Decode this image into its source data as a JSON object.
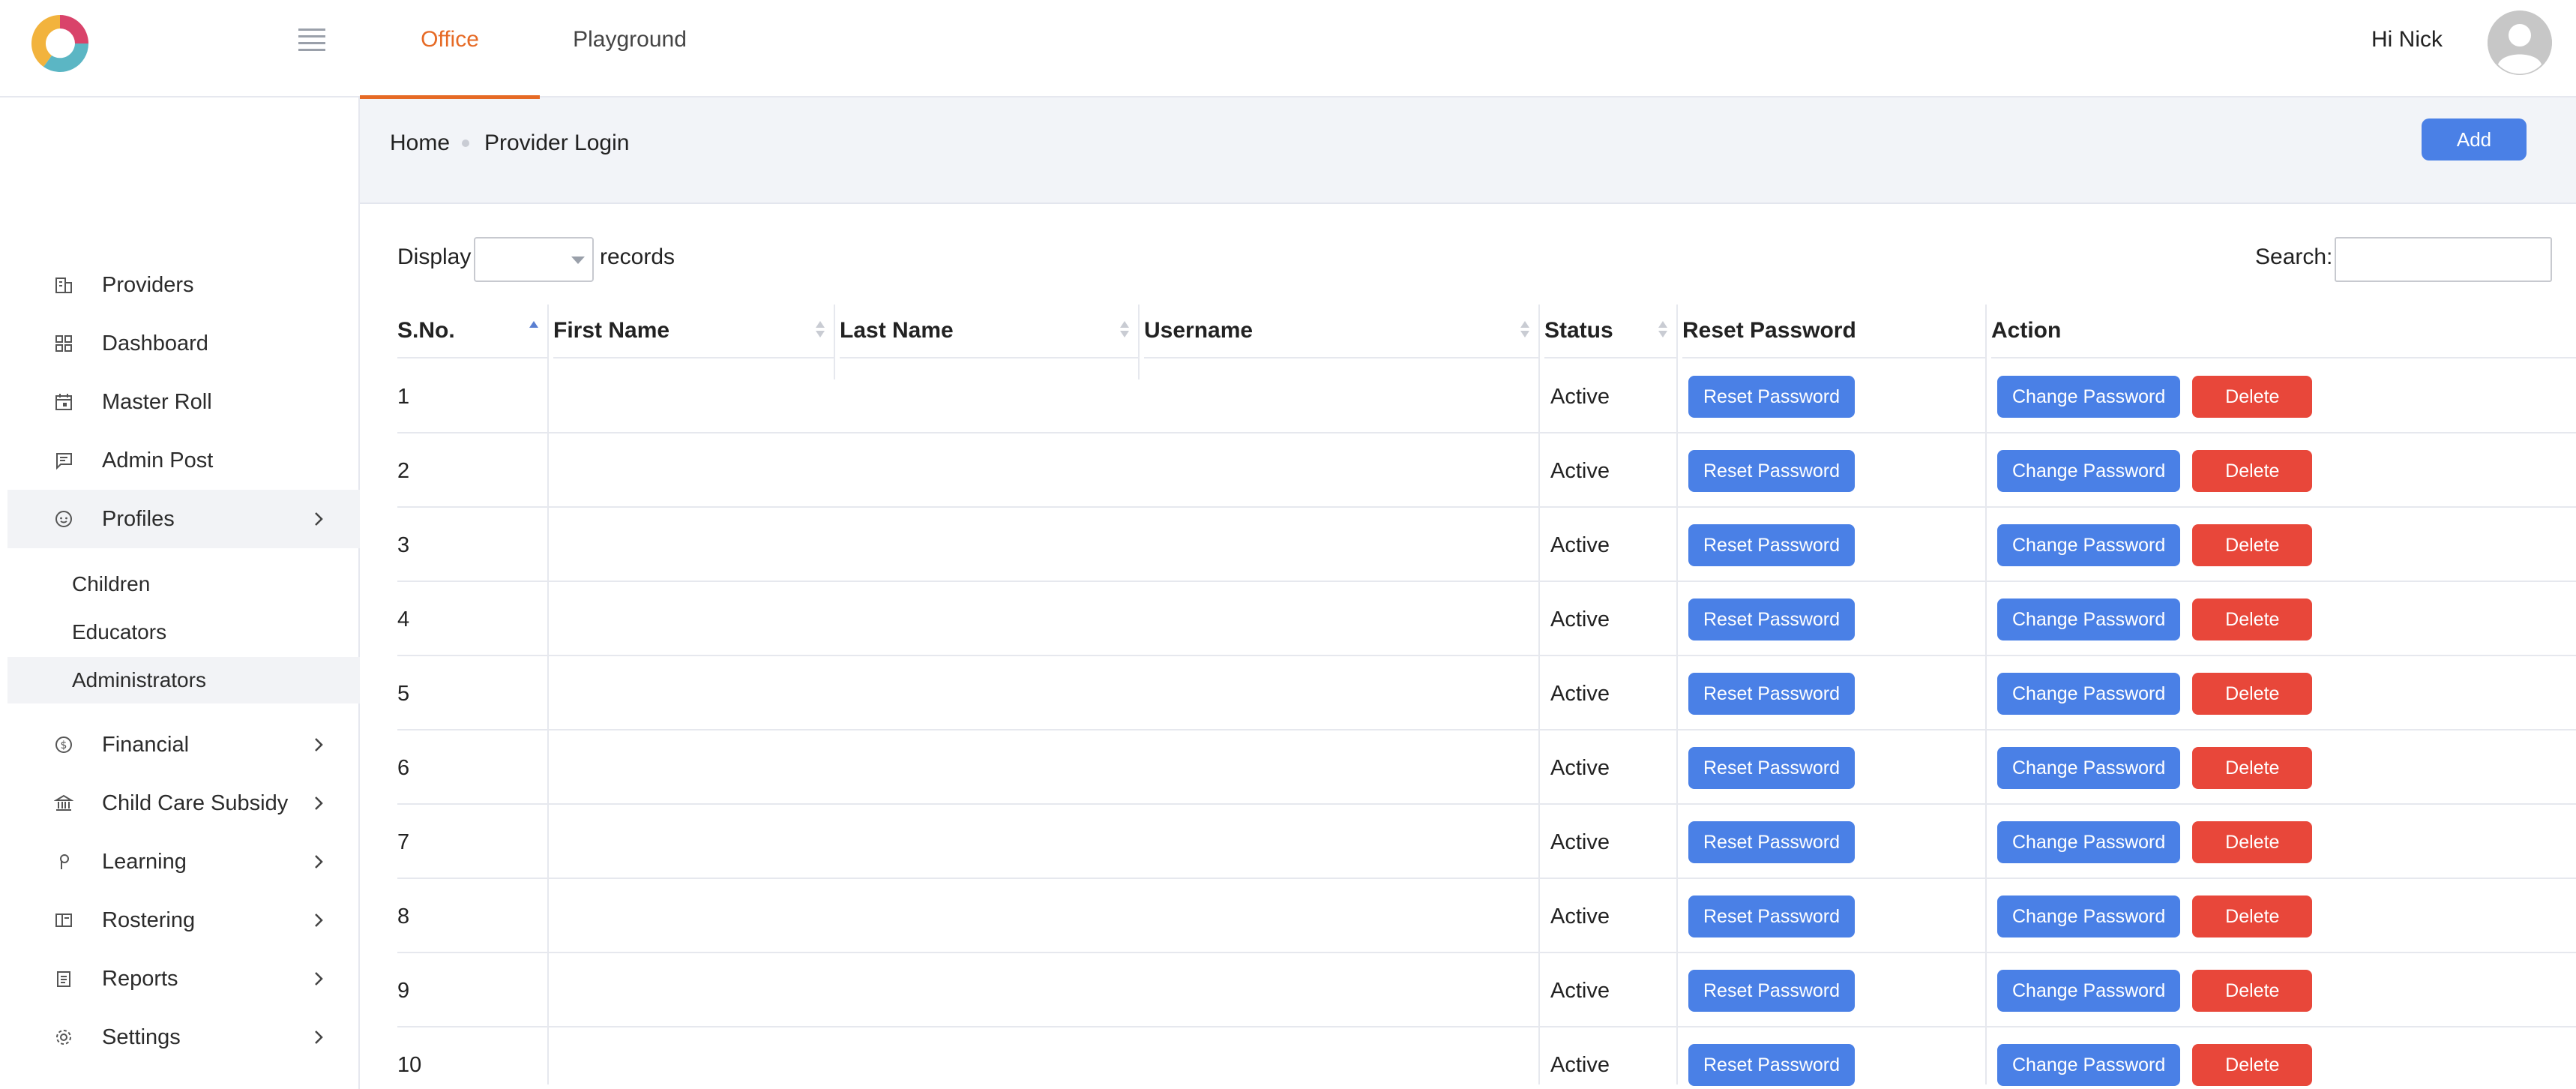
{
  "header": {
    "tabs": [
      {
        "label": "Office",
        "active": true
      },
      {
        "label": "Playground",
        "active": false
      }
    ],
    "greeting": "Hi Nick",
    "accent_color": "#e66a25"
  },
  "sidebar": {
    "items": [
      {
        "label": "Providers",
        "icon": "building-icon"
      },
      {
        "label": "Dashboard",
        "icon": "grid-icon"
      },
      {
        "label": "Master Roll",
        "icon": "calendar-icon"
      },
      {
        "label": "Admin Post",
        "icon": "message-icon"
      },
      {
        "label": "Profiles",
        "icon": "face-icon",
        "expanded": true
      },
      {
        "label": "Financial",
        "icon": "dollar-icon"
      },
      {
        "label": "Child Care Subsidy",
        "icon": "bank-icon"
      },
      {
        "label": "Learning",
        "icon": "pin-icon"
      },
      {
        "label": "Rostering",
        "icon": "columns-icon"
      },
      {
        "label": "Reports",
        "icon": "clipboard-icon"
      },
      {
        "label": "Settings",
        "icon": "gear-icon"
      }
    ],
    "profiles_sub": [
      "Children",
      "Educators",
      "Administrators"
    ]
  },
  "breadcrumb": {
    "home": "Home",
    "current": "Provider Login"
  },
  "toolbar": {
    "add_label": "Add"
  },
  "list_controls": {
    "display_label": "Display",
    "records_label": "records",
    "search_label": "Search:"
  },
  "table": {
    "columns": [
      "S.No.",
      "First Name",
      "Last Name",
      "Username",
      "Status",
      "Reset Password",
      "Action"
    ],
    "rows": [
      {
        "sno": "1",
        "status": "Active"
      },
      {
        "sno": "2",
        "status": "Active"
      },
      {
        "sno": "3",
        "status": "Active"
      },
      {
        "sno": "4",
        "status": "Active"
      },
      {
        "sno": "5",
        "status": "Active"
      },
      {
        "sno": "6",
        "status": "Active"
      },
      {
        "sno": "7",
        "status": "Active"
      },
      {
        "sno": "8",
        "status": "Active"
      },
      {
        "sno": "9",
        "status": "Active"
      },
      {
        "sno": "10",
        "status": "Active"
      }
    ],
    "reset_label": "Reset Password",
    "change_label": "Change Password",
    "delete_label": "Delete"
  },
  "colors": {
    "primary": "#4a80e6",
    "danger": "#e8473a"
  }
}
